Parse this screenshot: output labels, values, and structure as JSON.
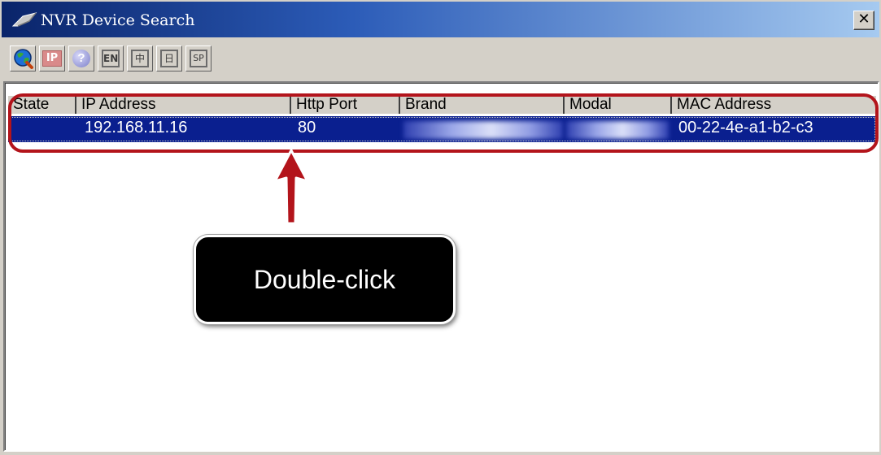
{
  "window": {
    "title": "NVR Device Search",
    "close_label": "✕"
  },
  "toolbar": {
    "buttons": [
      {
        "name": "search-icon"
      },
      {
        "name": "ip-icon",
        "label": "IP"
      },
      {
        "name": "help-icon",
        "label": "?"
      },
      {
        "name": "language-en",
        "label": "EN"
      },
      {
        "name": "language-zh",
        "label": "中"
      },
      {
        "name": "language-jp",
        "label": "日"
      },
      {
        "name": "language-sp",
        "label": "SP"
      }
    ]
  },
  "table": {
    "columns": [
      "State",
      "IP Address",
      "Http Port",
      "Brand",
      "Modal",
      "MAC Address"
    ],
    "rows": [
      {
        "state": "",
        "ip": "192.168.11.16",
        "port": "80",
        "brand": "",
        "modal": "",
        "mac": "00-22-4e-a1-b2-c3"
      }
    ]
  },
  "annotation": {
    "callout_text": "Double-click",
    "highlight_color": "#b3141b"
  },
  "colors": {
    "title_gradient_start": "#0a246a",
    "selection": "#0a1f8f",
    "window_face": "#d4d0c8"
  }
}
